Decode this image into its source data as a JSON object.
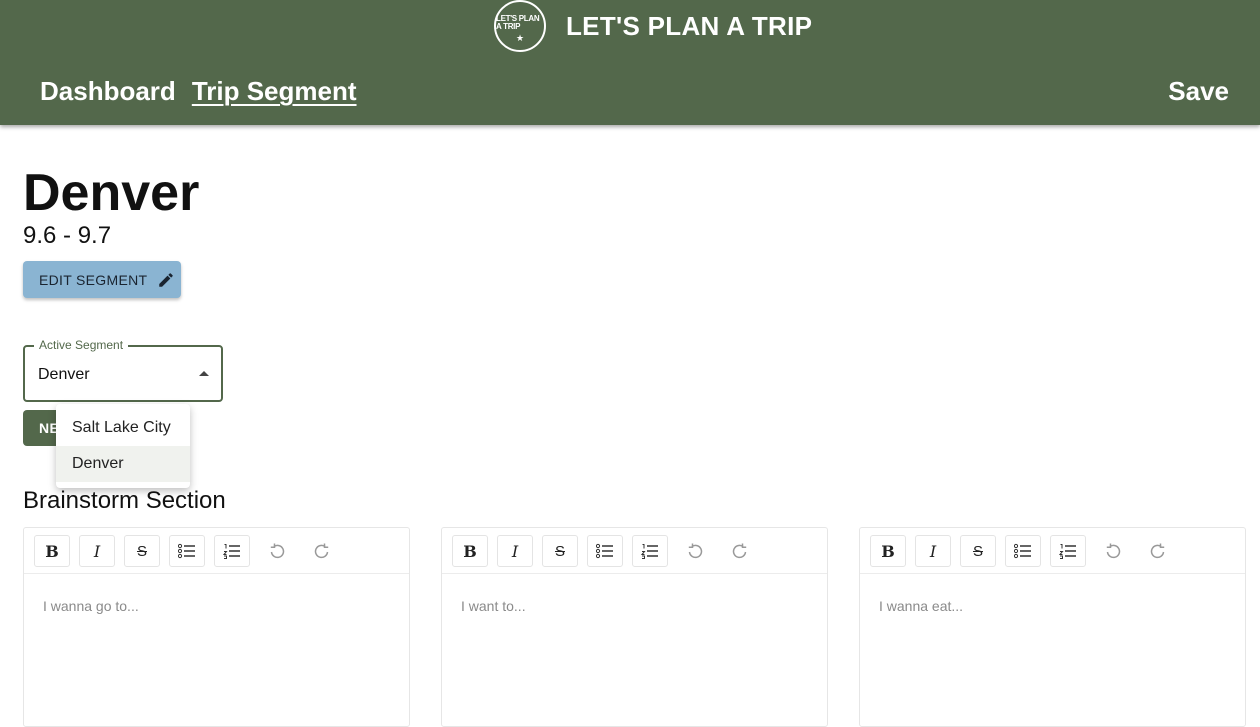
{
  "header": {
    "logo_text": "LET'S PLAN A TRIP",
    "logo_star": "★",
    "title": "LET'S PLAN A TRIP",
    "nav": [
      {
        "label": "Dashboard"
      },
      {
        "label": "Trip Segment"
      }
    ],
    "save_label": "Save",
    "colors": {
      "bar": "#53684b"
    }
  },
  "segment": {
    "title": "Denver",
    "dates": "9.6 - 9.7",
    "edit_label": "EDIT SEGMENT",
    "edit_icon": "pencil-icon"
  },
  "active_segment": {
    "legend": "Active Segment",
    "value": "Denver",
    "options": [
      "Salt Lake City",
      "Denver"
    ]
  },
  "new_button_label": "NE",
  "brainstorm": {
    "title": "Brainstorm Section",
    "toolbar_icons": [
      "bold-icon",
      "italic-icon",
      "strikethrough-icon",
      "bullet-list-icon",
      "numbered-list-icon",
      "undo-icon",
      "redo-icon"
    ],
    "toolbar_glyphs": {
      "bold": "B",
      "italic": "I",
      "strike": "S"
    },
    "editors": [
      {
        "placeholder": "I wanna go to..."
      },
      {
        "placeholder": "I want to..."
      },
      {
        "placeholder": "I wanna eat..."
      }
    ]
  }
}
